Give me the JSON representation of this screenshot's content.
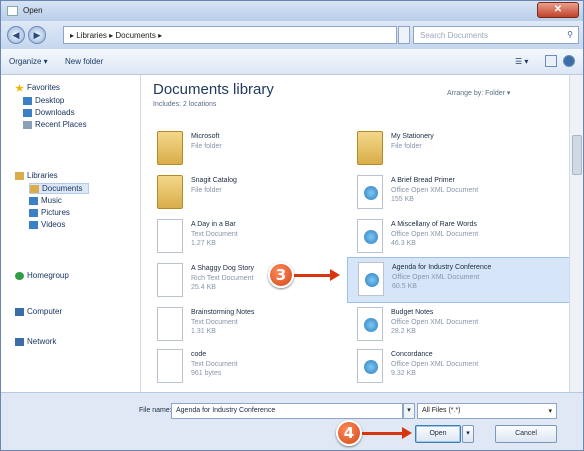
{
  "window": {
    "title": "Open",
    "close_label": "✕"
  },
  "address": {
    "path": "▸ Libraries ▸ Documents ▸",
    "search_placeholder": "Search Documents"
  },
  "toolbar": {
    "organize": "Organize ▾",
    "new_folder": "New folder",
    "view_glyph": "☰ ▾"
  },
  "sidebar": {
    "items": [
      {
        "label": "Favorites",
        "icon": "star-icon",
        "color": "#f0b400"
      },
      {
        "label": "Desktop",
        "icon": "desktop-icon",
        "color": "#3b7fc4"
      },
      {
        "label": "Downloads",
        "icon": "downloads-icon",
        "color": "#3b7fc4"
      },
      {
        "label": "Recent Places",
        "icon": "recent-places-icon",
        "color": "#8aa0b8"
      },
      {
        "label": "Libraries",
        "icon": "libraries-icon",
        "color": "#d9ad4a"
      },
      {
        "label": "Documents",
        "icon": "documents-icon",
        "color": "#d9ad4a"
      },
      {
        "label": "Music",
        "icon": "music-icon",
        "color": "#3b7fc4"
      },
      {
        "label": "Pictures",
        "icon": "pictures-icon",
        "color": "#3b7fc4"
      },
      {
        "label": "Videos",
        "icon": "videos-icon",
        "color": "#3b7fc4"
      },
      {
        "label": "Homegroup",
        "icon": "homegroup-icon",
        "color": "#2f9e44"
      },
      {
        "label": "Computer",
        "icon": "computer-icon",
        "color": "#3b6ea8"
      },
      {
        "label": "Network",
        "icon": "network-icon",
        "color": "#3b6ea8"
      }
    ]
  },
  "library": {
    "title": "Documents library",
    "includes": "Includes: 2 locations",
    "arrange_by": "Arrange by:  Folder ▾"
  },
  "files": [
    {
      "name": "Microsoft",
      "type": "File folder",
      "size": ""
    },
    {
      "name": "My Stationery",
      "type": "File folder",
      "size": ""
    },
    {
      "name": "Snagit Catalog",
      "type": "File folder",
      "size": ""
    },
    {
      "name": "A Brief Bread Primer",
      "type": "Office Open XML Document",
      "size": "155 KB"
    },
    {
      "name": "A Day in a Bar",
      "type": "Text Document",
      "size": "1.27 KB"
    },
    {
      "name": "A Miscellany of Rare Words",
      "type": "Office Open XML Document",
      "size": "46.3 KB"
    },
    {
      "name": "A Shaggy Dog Story",
      "type": "Rich Text Document",
      "size": "25.4 KB"
    },
    {
      "name": "Agenda for Industry Conference",
      "type": "Office Open XML Document",
      "size": "60.5 KB"
    },
    {
      "name": "Brainstorming Notes",
      "type": "Text Document",
      "size": "1.31 KB"
    },
    {
      "name": "Budget Notes",
      "type": "Office Open XML Document",
      "size": "28.2 KB"
    },
    {
      "name": "code",
      "type": "Text Document",
      "size": "961 bytes"
    },
    {
      "name": "Concordance",
      "type": "Office Open XML Document",
      "size": "9.32 KB"
    }
  ],
  "bottom": {
    "file_name_label": "File name:",
    "file_name_value": "Agenda for Industry Conference",
    "filter": "All Files (*.*)",
    "open": "Open",
    "cancel": "Cancel"
  },
  "callouts": {
    "step3": "3",
    "step4": "4"
  },
  "colors": {
    "accent": "#d24818",
    "selection": "#d6e6f8"
  }
}
